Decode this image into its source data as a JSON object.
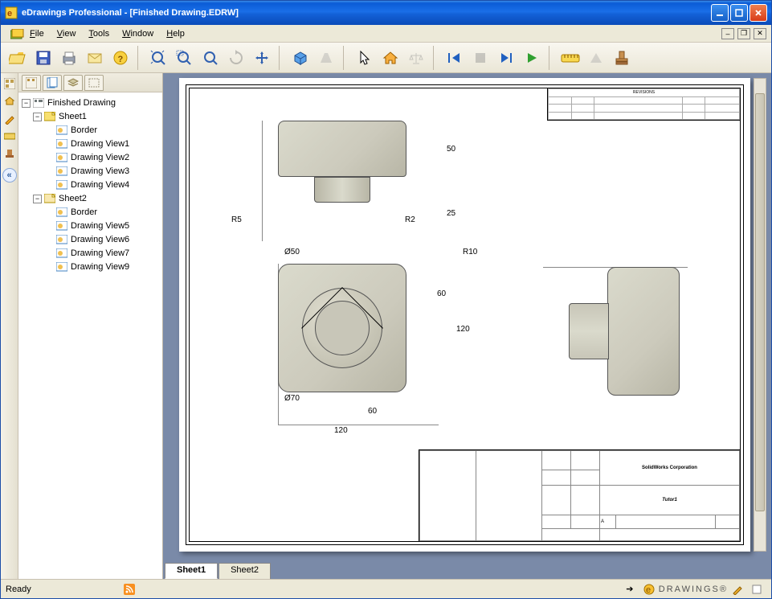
{
  "window": {
    "title": "eDrawings Professional - [Finished Drawing.EDRW]"
  },
  "menu": {
    "file": "File",
    "view": "View",
    "tools": "Tools",
    "window": "Window",
    "help": "Help"
  },
  "tree": {
    "root": "Finished Drawing",
    "sheet1": {
      "label": "Sheet1",
      "items": [
        "Border",
        "Drawing View1",
        "Drawing View2",
        "Drawing View3",
        "Drawing View4"
      ]
    },
    "sheet2": {
      "label": "Sheet2",
      "items": [
        "Border",
        "Drawing View5",
        "Drawing View6",
        "Drawing View7",
        "Drawing View9"
      ]
    }
  },
  "sheet_tabs": {
    "s1": "Sheet1",
    "s2": "Sheet2"
  },
  "status": {
    "ready": "Ready",
    "brand": "DRAWINGS®"
  },
  "drawing": {
    "dims": {
      "d120a": "120",
      "d60a": "60",
      "d60b": "60",
      "d120b": "120",
      "d50": "50",
      "d25": "25",
      "r5": "R5",
      "r2": "R2",
      "r10": "R10",
      "dia50": "Ø50",
      "dia70": "Ø70"
    }
  },
  "titleblock": {
    "company": "SolidWorks Corporation",
    "title": "Tutor1"
  },
  "revheader": "REVISIONS"
}
